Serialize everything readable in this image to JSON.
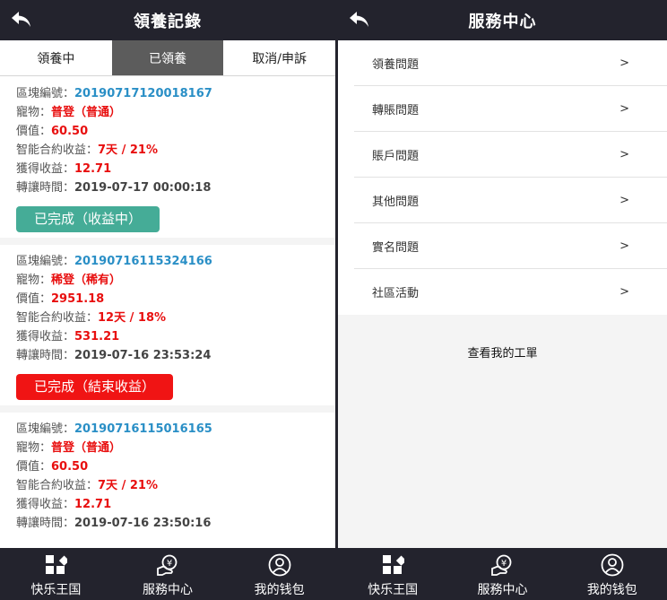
{
  "left": {
    "header": {
      "title": "領養記錄"
    },
    "tabs": [
      {
        "label": "領養中"
      },
      {
        "label": "已領養"
      },
      {
        "label": "取消/申訴"
      }
    ],
    "records": [
      {
        "block_label": "區塊編號：",
        "block_id": "20190717120018167",
        "pet_label": "寵物：",
        "pet": "普登（普通）",
        "price_label": "價值：",
        "price": "60.50",
        "contract_label": "智能合約收益：",
        "contract": "7天 / 21%",
        "earned_label": "獲得收益：",
        "earned": "12.71",
        "time_label": "轉讓時間：",
        "time": "2019-07-17 00:00:18",
        "status": "已完成（收益中）"
      },
      {
        "block_label": "區塊編號：",
        "block_id": "20190716115324166",
        "pet_label": "寵物：",
        "pet": "稀登（稀有）",
        "price_label": "價值：",
        "price": "2951.18",
        "contract_label": "智能合約收益：",
        "contract": "12天 / 18%",
        "earned_label": "獲得收益：",
        "earned": "531.21",
        "time_label": "轉讓時間：",
        "time": "2019-07-16 23:53:24",
        "status": "已完成（結束收益）"
      },
      {
        "block_label": "區塊編號：",
        "block_id": "20190716115016165",
        "pet_label": "寵物：",
        "pet": "普登（普通）",
        "price_label": "價值：",
        "price": "60.50",
        "contract_label": "智能合約收益：",
        "contract": "7天 / 21%",
        "earned_label": "獲得收益：",
        "earned": "12.71",
        "time_label": "轉讓時間：",
        "time": "2019-07-16 23:50:16"
      }
    ],
    "footer": [
      {
        "label": "快乐王国",
        "icon": "grid-icon"
      },
      {
        "label": "服務中心",
        "icon": "service-icon"
      },
      {
        "label": "我的钱包",
        "icon": "wallet-icon"
      }
    ]
  },
  "right": {
    "header": {
      "title": "服務中心"
    },
    "items": [
      {
        "label": "領養問題",
        "arrow": ">"
      },
      {
        "label": "轉賬問題",
        "arrow": ">"
      },
      {
        "label": "賬戶問題",
        "arrow": ">"
      },
      {
        "label": "其他問題",
        "arrow": ">"
      },
      {
        "label": "實名問題",
        "arrow": ">"
      },
      {
        "label": "社區活動",
        "arrow": ">"
      }
    ],
    "ticket_link": "查看我的工單",
    "footer": [
      {
        "label": "快乐王国",
        "icon": "grid-icon"
      },
      {
        "label": "服務中心",
        "icon": "service-icon"
      },
      {
        "label": "我的钱包",
        "icon": "wallet-icon"
      }
    ]
  },
  "colors": {
    "header_bg": "#23232d",
    "active_tab_bg": "#5c5c5c",
    "block_id": "#2a8fc6",
    "value_red": "#e80e0e",
    "status_green": "#45ac97",
    "status_red": "#f01414"
  }
}
